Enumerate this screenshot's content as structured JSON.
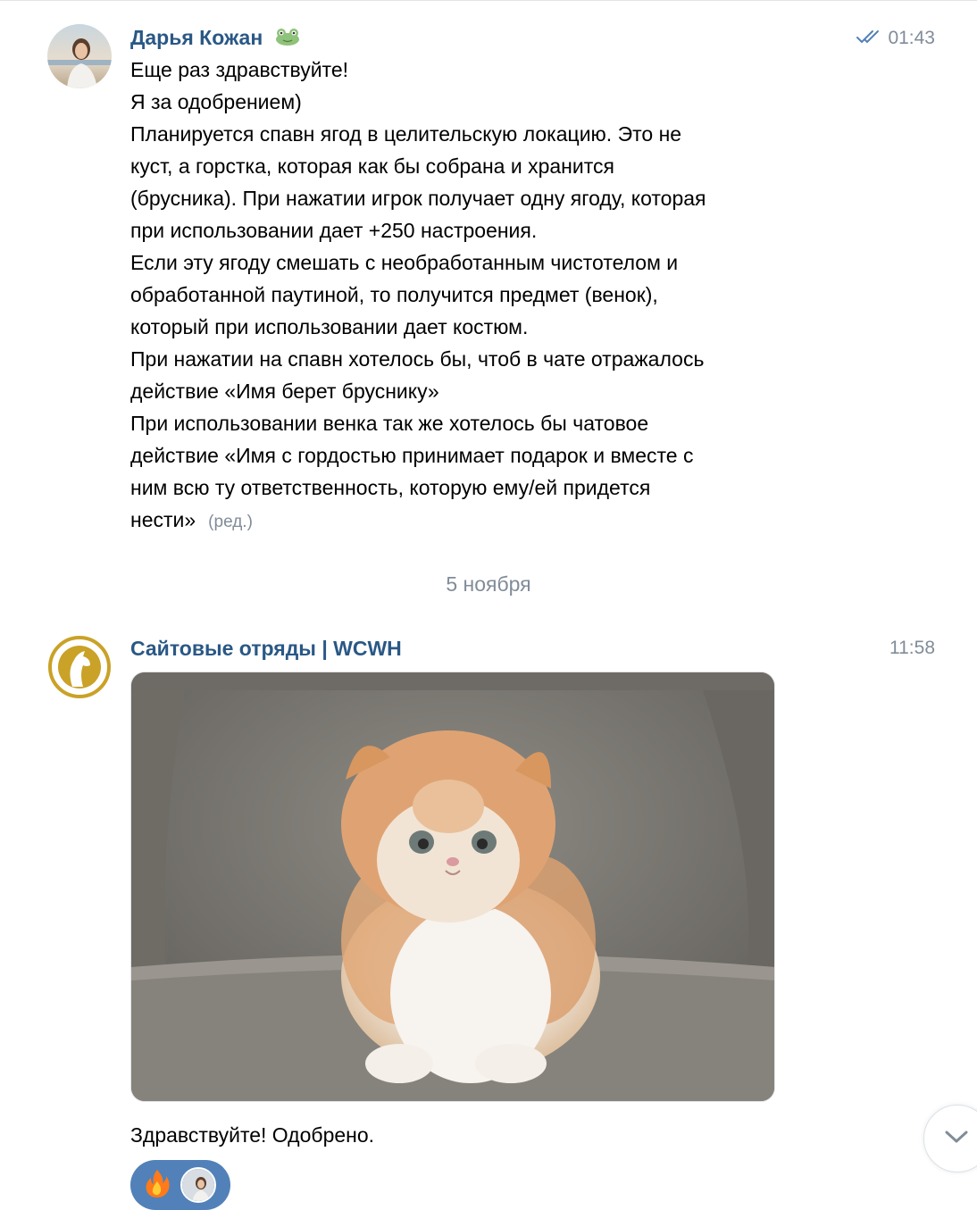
{
  "message1": {
    "author": "Дарья Кожан",
    "author_emoji": "frog-icon",
    "time": "01:43",
    "status": "read-double-check",
    "lines": [
      "Еще раз здравствуйте!",
      "Я за одобрением)",
      "Планируется спавн ягод в целительскую локацию. Это не",
      "куст, а горстка, которая как бы собрана и хранится",
      "(брусника). При нажатии игрок получает одну ягоду, которая",
      "при использовании дает +250 настроения.",
      "Если эту ягоду смешать с необработанным чистотелом и",
      "обработанной паутиной, то получится предмет (венок),",
      "который при использовании дает костюм.",
      "При нажатии на спавн хотелось бы, чтоб в чате отражалось",
      "действие «Имя берет бруснику»",
      "При использовании венка так же хотелось бы чатовое",
      "действие «Имя с гордостью принимает подарок и вместе с",
      "ним всю ту ответственность, которую ему/ей придется",
      "нести»"
    ],
    "edited_label": "(ред.)"
  },
  "date_separator": "5 ноября",
  "message2": {
    "author": "Сайтовые отряды | WCWH",
    "time": "11:58",
    "photo": "fluffy-kitten-photo",
    "text": "Здравствуйте! Одобрено.",
    "reactions": [
      "fire-icon",
      "user-avatar"
    ]
  },
  "colors": {
    "author_link": "#2a5885",
    "meta_gray": "#818c99",
    "reaction_bg": "#5181b8",
    "logo_gold": "#c9a227"
  }
}
